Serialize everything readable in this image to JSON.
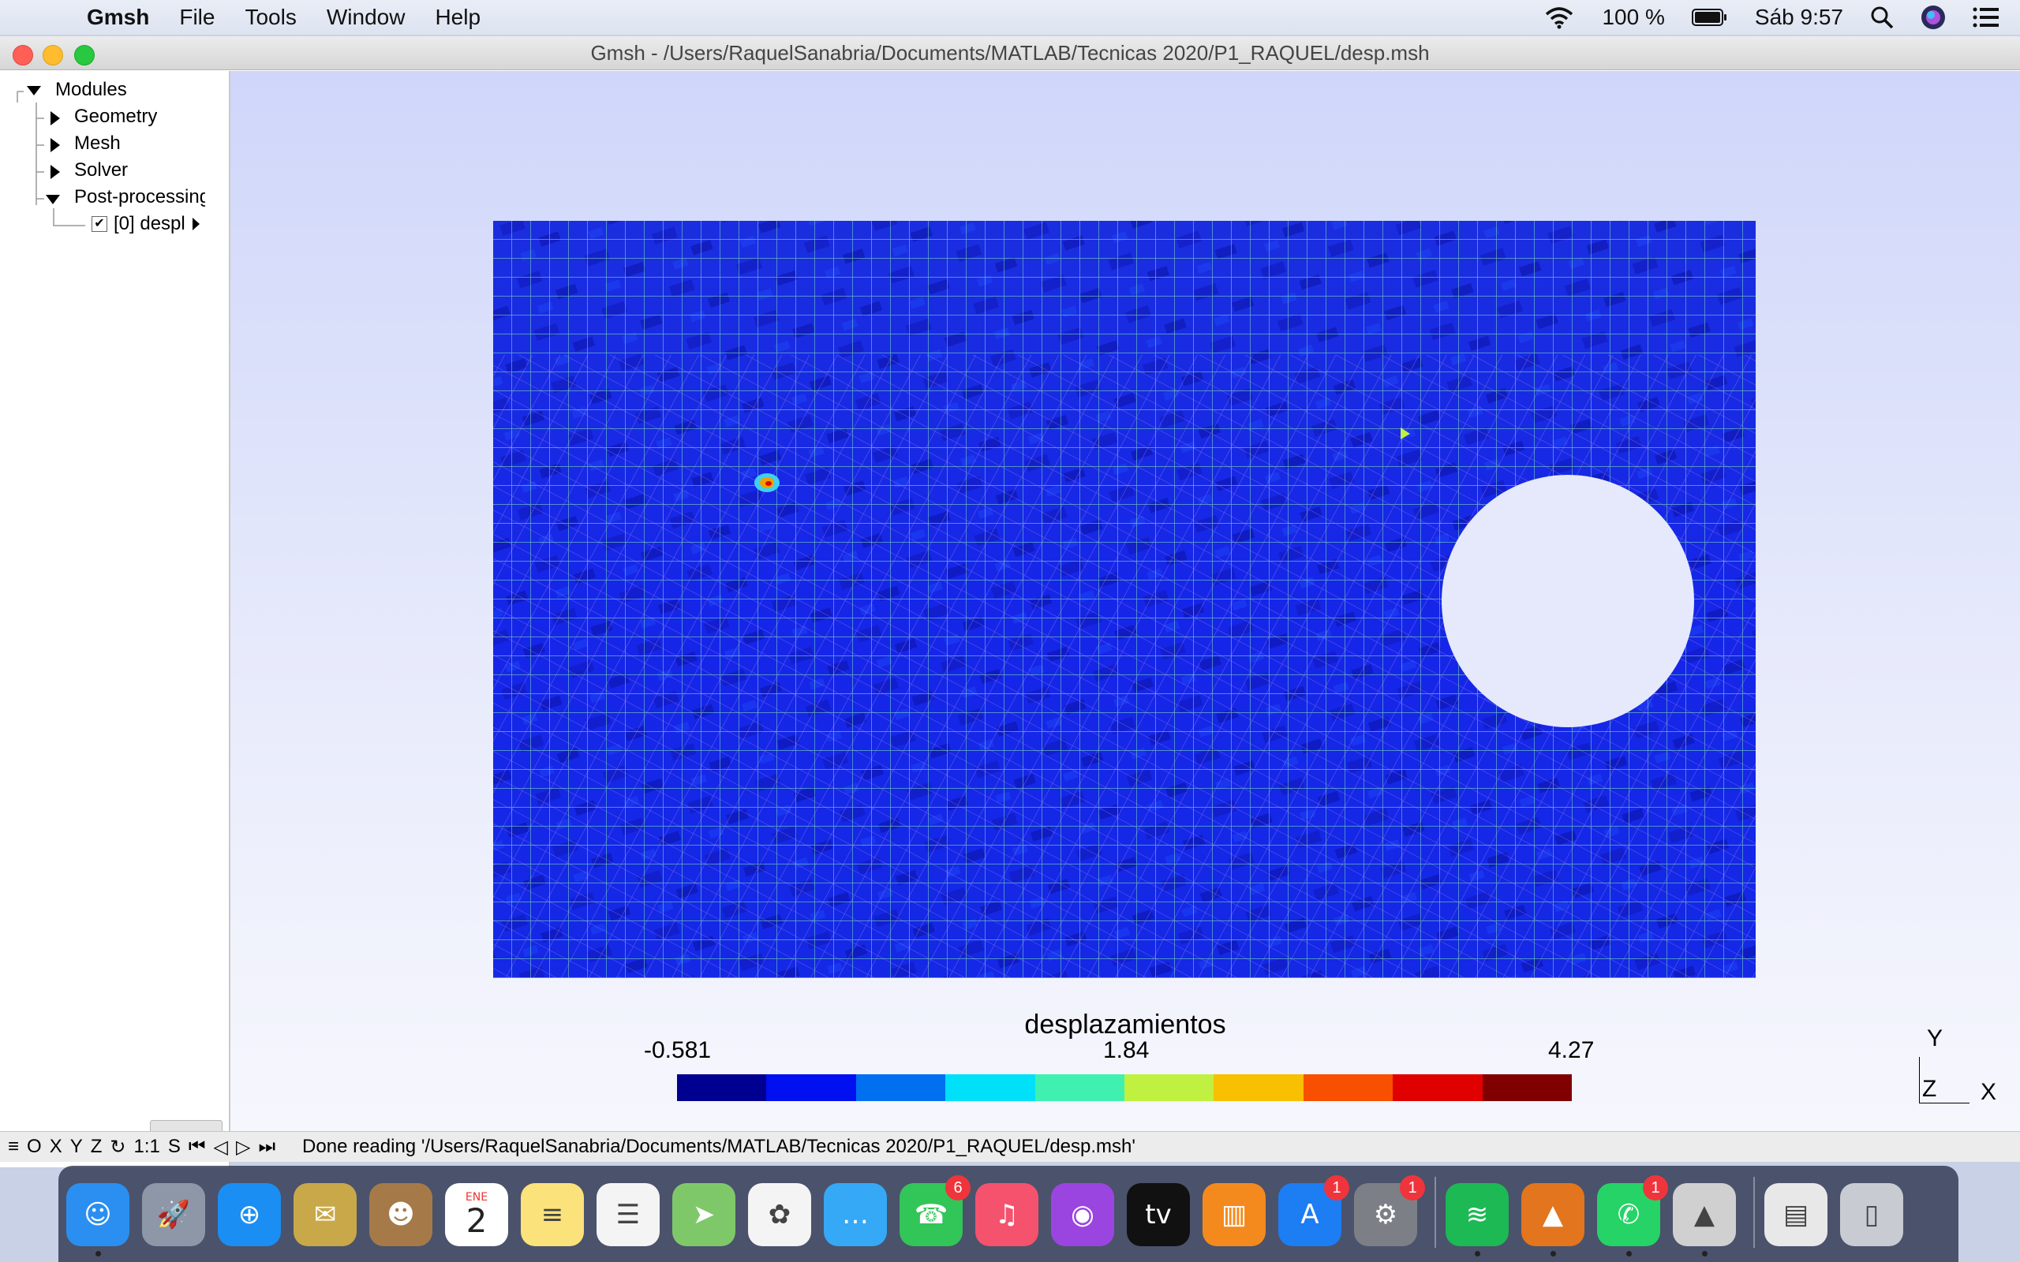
{
  "menubar": {
    "app_name": "Gmsh",
    "items": [
      "File",
      "Tools",
      "Window",
      "Help"
    ],
    "battery": "100 %",
    "clock": "Sáb 9:57"
  },
  "window": {
    "title": "Gmsh - /Users/RaquelSanabria/Documents/MATLAB/Tecnicas 2020/P1_RAQUEL/desp.msh"
  },
  "tree": {
    "root": "Modules",
    "geometry": "Geometry",
    "mesh": "Mesh",
    "solver": "Solver",
    "postprocessing": "Post-processing",
    "view": "[0] despl"
  },
  "plot": {
    "title": "desplazamientos",
    "min": "-0.581",
    "mid": "1.84",
    "max": "4.27",
    "colors": [
      "#000090",
      "#0010f0",
      "#0070f0",
      "#00e0f8",
      "#40f0b0",
      "#c0f040",
      "#f8c000",
      "#f85000",
      "#e00000",
      "#800000"
    ]
  },
  "axes": {
    "y": "Y",
    "z": "Z",
    "x": "X"
  },
  "statusbar": {
    "buttons": [
      "O",
      "X",
      "Y",
      "Z",
      "1:1",
      "S"
    ],
    "message": "Done reading '/Users/RaquelSanabria/Documents/MATLAB/Tecnicas 2020/P1_RAQUEL/desp.msh'"
  },
  "dock": {
    "calendar_month": "ENE",
    "calendar_day": "2",
    "facetime_badge": "6",
    "appstore_badge": "1",
    "prefs_badge": "1",
    "whatsapp_badge": "1",
    "apps": [
      {
        "name": "finder",
        "color": "#2a8ff0"
      },
      {
        "name": "launchpad",
        "color": "#8d97a8"
      },
      {
        "name": "safari",
        "color": "#1a8ef2"
      },
      {
        "name": "mail",
        "color": "#c9a84a"
      },
      {
        "name": "contacts",
        "color": "#a57a48"
      },
      {
        "name": "calendar",
        "color": "#ffffff"
      },
      {
        "name": "notes",
        "color": "#fbe27a"
      },
      {
        "name": "reminders",
        "color": "#f4f4f4"
      },
      {
        "name": "maps",
        "color": "#7fc86a"
      },
      {
        "name": "photos",
        "color": "#f4f4f4"
      },
      {
        "name": "messages",
        "color": "#35a8f6"
      },
      {
        "name": "facetime",
        "color": "#32c558"
      },
      {
        "name": "music",
        "color": "#f5526e"
      },
      {
        "name": "podcasts",
        "color": "#9b45e0"
      },
      {
        "name": "tv",
        "color": "#111111"
      },
      {
        "name": "books",
        "color": "#f48a1e"
      },
      {
        "name": "app-store",
        "color": "#1d7df2"
      },
      {
        "name": "system-preferences",
        "color": "#7c7f86"
      },
      {
        "name": "spotify",
        "color": "#1db954"
      },
      {
        "name": "matlab",
        "color": "#e2751d"
      },
      {
        "name": "whatsapp",
        "color": "#25d366"
      },
      {
        "name": "gmsh",
        "color": "#d0d0d0"
      },
      {
        "name": "documents",
        "color": "#e8e8e8"
      },
      {
        "name": "trash",
        "color": "#c8ccd2"
      }
    ]
  }
}
